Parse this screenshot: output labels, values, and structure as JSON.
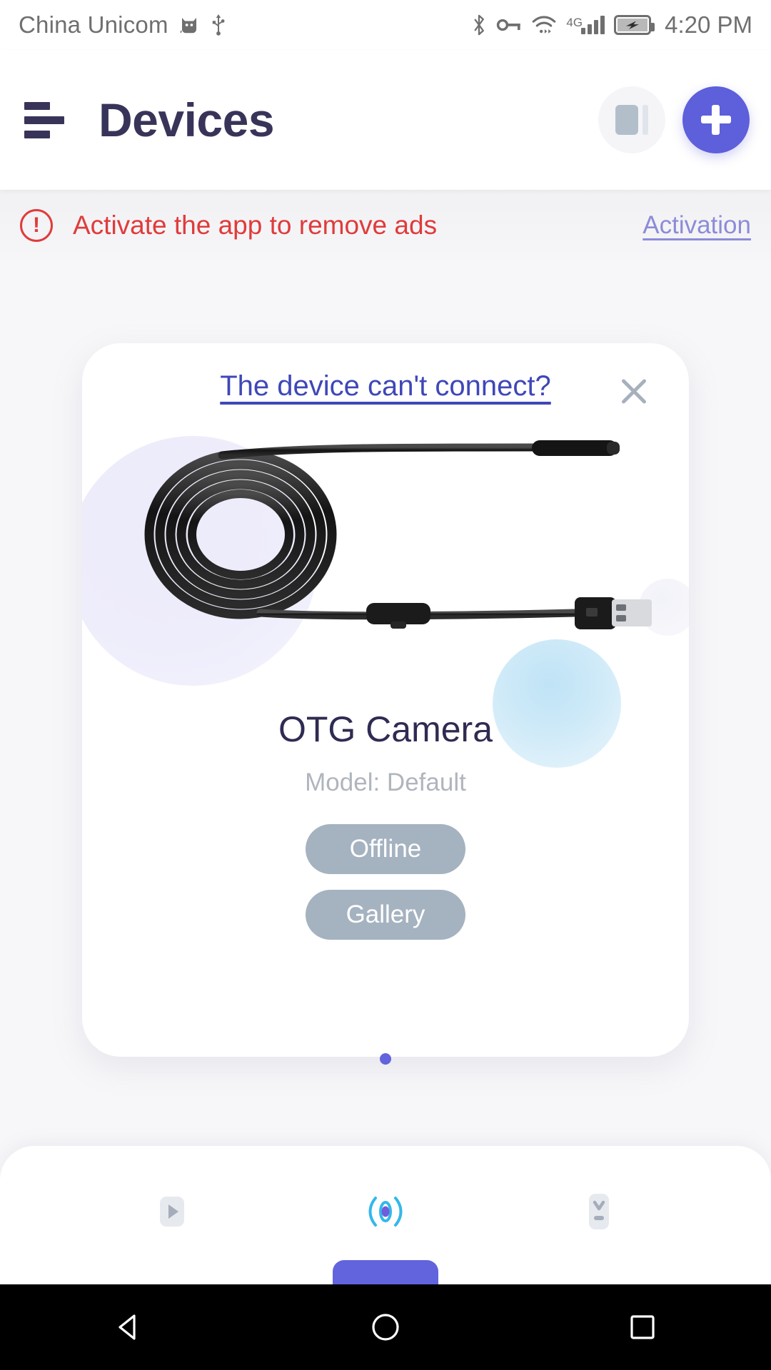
{
  "status_bar": {
    "carrier": "China Unicom",
    "cat_icon": "cat-icon",
    "usb_icon": "usb-icon",
    "bluetooth_icon": "bluetooth-icon",
    "vpn_key_icon": "vpn-key-icon",
    "wifi_icon": "wifi-icon",
    "network_type": "4G",
    "signal_icon": "cellular-signal-icon",
    "battery_icon": "battery-charging-icon",
    "time": "4:20 PM"
  },
  "header": {
    "menu_icon": "hamburger-menu-icon",
    "title": "Devices",
    "layout_button_icon": "layout-toggle-icon",
    "add_button_icon": "plus-icon"
  },
  "ad_banner": {
    "warn_icon": "warning-exclamation-icon",
    "warn_glyph": "!",
    "message": "Activate the app to remove ads",
    "action_label": "Activation"
  },
  "device_card": {
    "help_link": "The device can't connect?",
    "close_icon": "close-icon",
    "illustration": "usb-endoscope-camera-cable",
    "name": "OTG Camera",
    "model": "Model: Default",
    "buttons": [
      {
        "label": "Offline",
        "name": "offline-button"
      },
      {
        "label": "Gallery",
        "name": "gallery-button"
      }
    ],
    "page_dots": {
      "count": 1,
      "active": 0,
      "color": "#6164dd"
    }
  },
  "bottom_tabs": [
    {
      "name": "tab-media",
      "icon": "play-media-icon",
      "active": false
    },
    {
      "name": "tab-connect",
      "icon": "broadcast-signal-icon",
      "active": true
    },
    {
      "name": "tab-download",
      "icon": "download-device-icon",
      "active": false
    }
  ],
  "android_nav": [
    {
      "name": "nav-back",
      "icon": "back-triangle-icon"
    },
    {
      "name": "nav-home",
      "icon": "home-circle-icon"
    },
    {
      "name": "nav-recents",
      "icon": "recents-square-icon"
    }
  ],
  "colors": {
    "accent": "#5d5fdb",
    "title": "#383459",
    "alert": "#e03b3b",
    "link": "#3f47b8",
    "pill": "#a5b2c0",
    "muted": "#b0b5bd"
  }
}
